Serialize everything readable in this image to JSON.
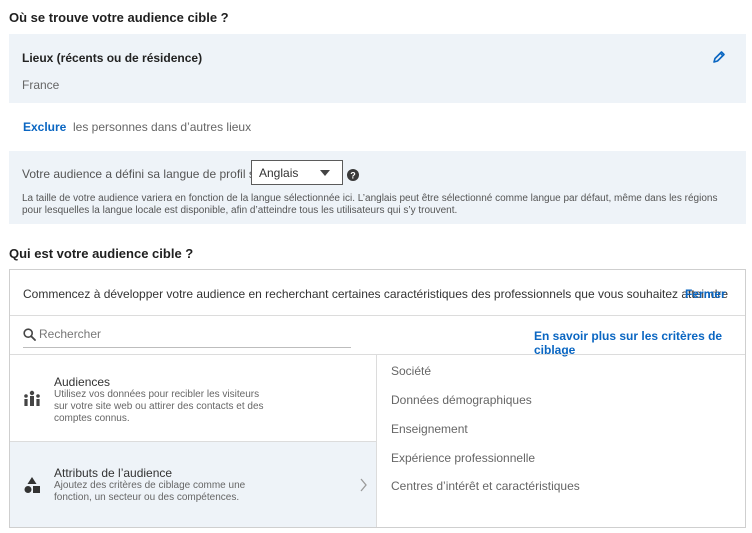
{
  "location_section": {
    "heading": "Où se trouve votre audience cible ?",
    "box_title": "Lieux (récents ou de résidence)",
    "selected_location": "France",
    "edit_icon": "pencil-icon",
    "exclude_link": "Exclure",
    "exclude_text": "les personnes dans d’autres lieux"
  },
  "language_section": {
    "prompt": "Votre audience a défini sa langue de profil sur",
    "selected_language": "Anglais",
    "help_icon": "question-circle-icon",
    "note": "La taille de votre audience variera en fonction de la langue sélectionnée ici. L’anglais peut être sélectionné comme langue par défaut, même dans les régions pour lesquelles la langue locale est disponible, afin d’atteindre tous les utilisateurs qui s’y trouvent."
  },
  "audience_section": {
    "heading": "Qui est votre audience cible ?",
    "intro": "Commencez à développer votre audience en recherchant certaines caractéristiques des professionnels que vous souhaitez atteindre",
    "close_link": "Fermer",
    "search_placeholder": "Rechercher",
    "learn_more_link": "En savoir plus sur les critères de ciblage",
    "left_items": [
      {
        "title": "Audiences",
        "description": "Utilisez vos données pour recibler les visiteurs sur votre site web ou attirer des contacts et des comptes connus.",
        "icon": "bar-chart-people-icon"
      },
      {
        "title": "Attributs de l’audience",
        "description": "Ajoutez des critères de ciblage comme une fonction, un secteur ou des compétences.",
        "icon": "shapes-icon"
      }
    ],
    "right_items": [
      "Société",
      "Données démographiques",
      "Enseignement",
      "Expérience professionnelle",
      "Centres d’intérêt et caractéristiques"
    ]
  }
}
